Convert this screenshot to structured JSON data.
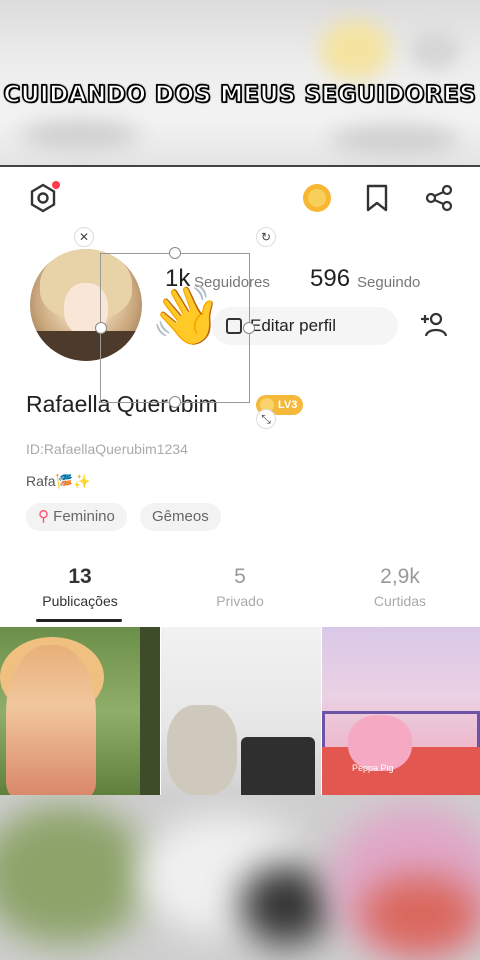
{
  "caption": "CUIDANDO DOS MEUS SEGUIDORES",
  "header": {
    "settings_icon": "gear-icon",
    "coin_icon": "coin-icon",
    "bookmark_icon": "bookmark-icon",
    "share_icon": "share-icon"
  },
  "profile": {
    "followers_count": "1k",
    "followers_label": "Seguidores",
    "following_count": "596",
    "following_label": "Seguindo",
    "edit_label": "Editar perfil",
    "name": "Rafaella Querubim",
    "level": "LV3",
    "user_id": "ID:RafaellaQuerubim1234",
    "bio": "Rafa🎏✨",
    "tags": [
      "Feminino",
      "Gêmeos"
    ]
  },
  "tabs": [
    {
      "count": "13",
      "label": "Publicações"
    },
    {
      "count": "5",
      "label": "Privado"
    },
    {
      "count": "2,9k",
      "label": "Curtidas"
    }
  ],
  "grid_caption": "Peppa Pig",
  "overlay_emoji": "👋",
  "colors": {
    "accent_badge": "#f4b83a",
    "notification_dot": "#ff3b4a"
  }
}
